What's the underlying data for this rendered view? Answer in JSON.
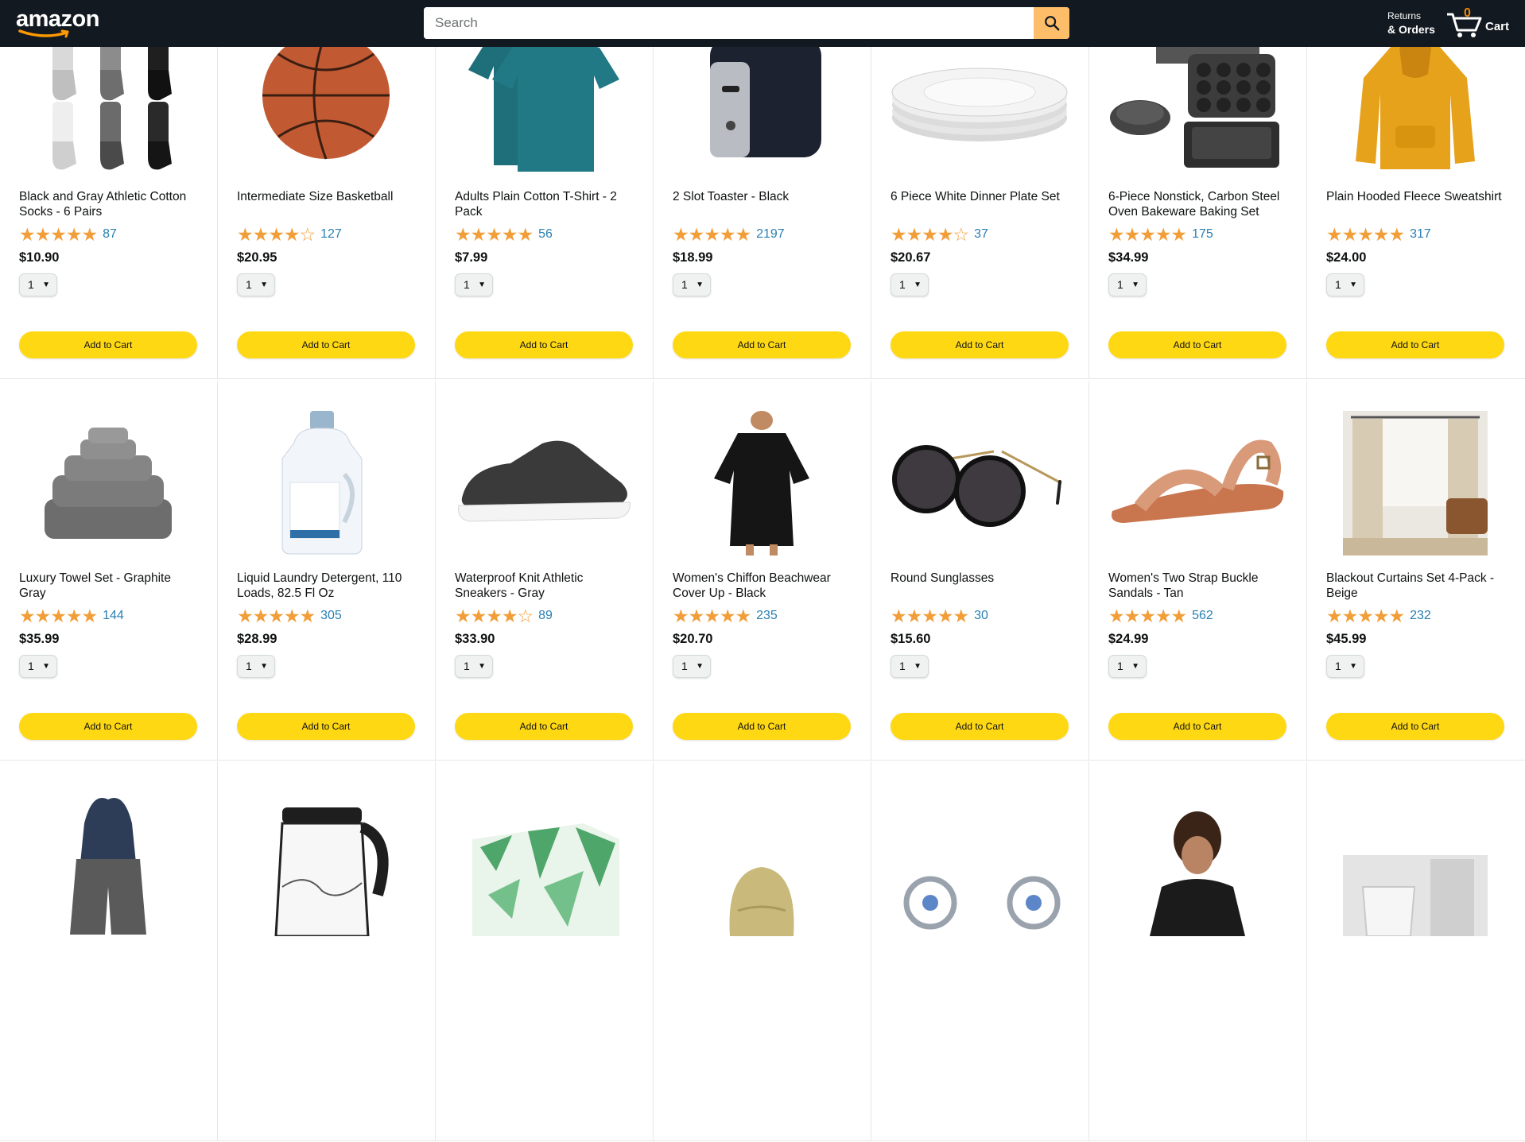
{
  "header": {
    "logo": "amazon",
    "search_placeholder": "Search",
    "returns_line1": "Returns",
    "returns_line2": "& Orders",
    "cart_count": "0",
    "cart_label": "Cart"
  },
  "colors": {
    "header_bg": "#131921",
    "search_button": "#febd69",
    "add_to_cart": "#ffd814",
    "stars": "#f19e39",
    "rating_count": "#2a7fb2"
  },
  "products_row1": [
    {
      "title": "Black and Gray Athletic Cotton Socks - 6 Pairs",
      "stars": "★★★★★",
      "rating": 4.5,
      "count": "87",
      "price": "$10.90",
      "qty": "1",
      "button": "Add to Cart",
      "image": "socks"
    },
    {
      "title": "Intermediate Size Basketball",
      "stars": "★★★★☆",
      "rating": 4.0,
      "count": "127",
      "price": "$20.95",
      "qty": "1",
      "button": "Add to Cart",
      "image": "basketball"
    },
    {
      "title": "Adults Plain Cotton T-Shirt - 2 Pack",
      "stars": "★★★★★",
      "rating": 4.5,
      "count": "56",
      "price": "$7.99",
      "qty": "1",
      "button": "Add to Cart",
      "image": "tshirt"
    },
    {
      "title": "2 Slot Toaster - Black",
      "stars": "★★★★★",
      "rating": 5.0,
      "count": "2197",
      "price": "$18.99",
      "qty": "1",
      "button": "Add to Cart",
      "image": "toaster"
    },
    {
      "title": "6 Piece White Dinner Plate Set",
      "stars": "★★★★☆",
      "rating": 4.0,
      "count": "37",
      "price": "$20.67",
      "qty": "1",
      "button": "Add to Cart",
      "image": "plates"
    },
    {
      "title": "6-Piece Nonstick, Carbon Steel Oven Bakeware Baking Set",
      "stars": "★★★★★",
      "rating": 4.5,
      "count": "175",
      "price": "$34.99",
      "qty": "1",
      "button": "Add to Cart",
      "image": "bakeware"
    },
    {
      "title": "Plain Hooded Fleece Sweatshirt",
      "stars": "★★★★★",
      "rating": 4.5,
      "count": "317",
      "price": "$24.00",
      "qty": "1",
      "button": "Add to Cart",
      "image": "hoodie"
    }
  ],
  "products_row2": [
    {
      "title": "Luxury Towel Set - Graphite Gray",
      "stars": "★★★★★",
      "rating": 4.5,
      "count": "144",
      "price": "$35.99",
      "qty": "1",
      "button": "Add to Cart",
      "image": "towels"
    },
    {
      "title": "Liquid Laundry Detergent, 110 Loads, 82.5 Fl Oz",
      "stars": "★★★★★",
      "rating": 4.5,
      "count": "305",
      "price": "$28.99",
      "qty": "1",
      "button": "Add to Cart",
      "image": "detergent"
    },
    {
      "title": "Waterproof Knit Athletic Sneakers - Gray",
      "stars": "★★★★☆",
      "rating": 4.0,
      "count": "89",
      "price": "$33.90",
      "qty": "1",
      "button": "Add to Cart",
      "image": "sneaker"
    },
    {
      "title": "Women's Chiffon Beachwear Cover Up - Black",
      "stars": "★★★★★",
      "rating": 4.5,
      "count": "235",
      "price": "$20.70",
      "qty": "1",
      "button": "Add to Cart",
      "image": "coverup"
    },
    {
      "title": "Round Sunglasses",
      "stars": "★★★★★",
      "rating": 4.5,
      "count": "30",
      "price": "$15.60",
      "qty": "1",
      "button": "Add to Cart",
      "image": "sunglasses"
    },
    {
      "title": "Women's Two Strap Buckle Sandals - Tan",
      "stars": "★★★★★",
      "rating": 4.5,
      "count": "562",
      "price": "$24.99",
      "qty": "1",
      "button": "Add to Cart",
      "image": "sandal"
    },
    {
      "title": "Blackout Curtains Set 4-Pack - Beige",
      "stars": "★★★★★",
      "rating": 4.5,
      "count": "232",
      "price": "$45.99",
      "qty": "1",
      "button": "Add to Cart",
      "image": "curtains"
    }
  ],
  "products_row3_images": [
    "shorts",
    "kettle",
    "tissue-box",
    "straw-hat",
    "earrings",
    "black-top",
    "bathroom-set"
  ]
}
